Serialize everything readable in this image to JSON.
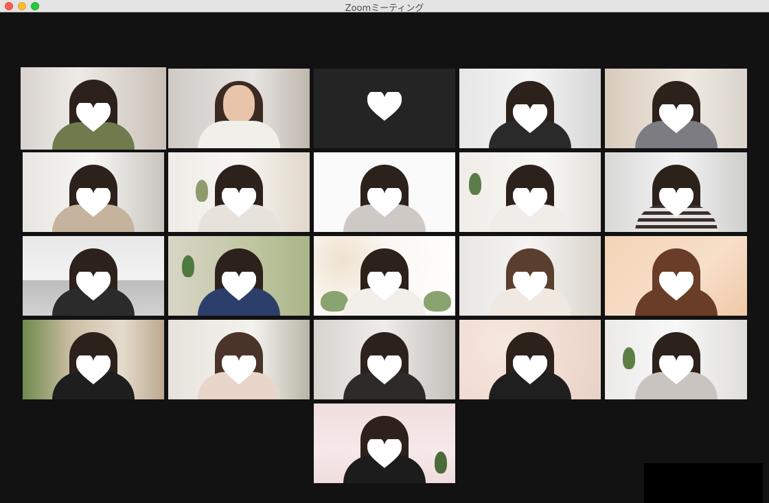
{
  "window": {
    "title": "Zoomミーティング"
  },
  "colors": {
    "active_border": "#d9ef67",
    "background": "#121212"
  },
  "participants": [
    {
      "id": 1,
      "active": true,
      "video": true
    },
    {
      "id": 2,
      "active": false,
      "video": true
    },
    {
      "id": 3,
      "active": false,
      "video": false
    },
    {
      "id": 4,
      "active": false,
      "video": true
    },
    {
      "id": 5,
      "active": false,
      "video": true
    },
    {
      "id": 6,
      "active": false,
      "video": true
    },
    {
      "id": 7,
      "active": false,
      "video": true
    },
    {
      "id": 8,
      "active": false,
      "video": true
    },
    {
      "id": 9,
      "active": false,
      "video": true
    },
    {
      "id": 10,
      "active": false,
      "video": true
    },
    {
      "id": 11,
      "active": false,
      "video": true
    },
    {
      "id": 12,
      "active": false,
      "video": true
    },
    {
      "id": 13,
      "active": false,
      "video": true
    },
    {
      "id": 14,
      "active": false,
      "video": true
    },
    {
      "id": 15,
      "active": false,
      "video": true
    },
    {
      "id": 16,
      "active": false,
      "video": true
    },
    {
      "id": 17,
      "active": false,
      "video": true
    },
    {
      "id": 18,
      "active": false,
      "video": true
    },
    {
      "id": 19,
      "active": false,
      "video": true
    },
    {
      "id": 20,
      "active": false,
      "video": true
    },
    {
      "id": 21,
      "active": false,
      "video": true
    }
  ]
}
